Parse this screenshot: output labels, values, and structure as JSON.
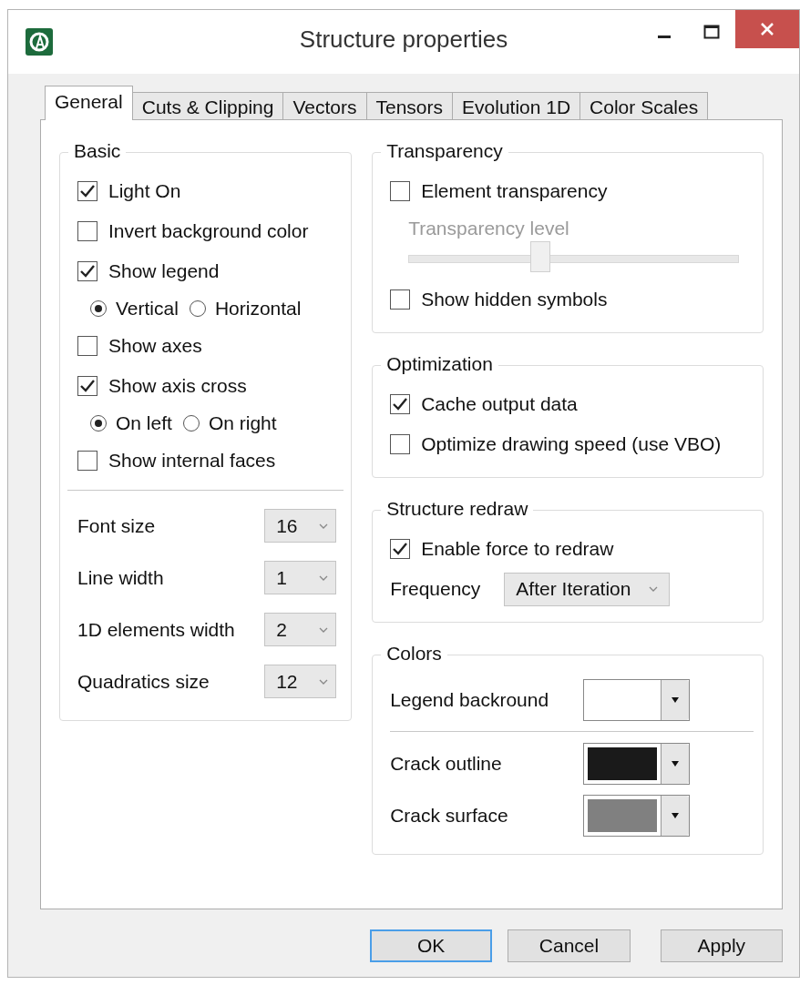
{
  "window": {
    "title": "Structure properties"
  },
  "tabs": [
    {
      "label": "General",
      "selected": true
    },
    {
      "label": "Cuts & Clipping",
      "selected": false
    },
    {
      "label": "Vectors",
      "selected": false
    },
    {
      "label": "Tensors",
      "selected": false
    },
    {
      "label": "Evolution 1D",
      "selected": false
    },
    {
      "label": "Color Scales",
      "selected": false
    }
  ],
  "basic": {
    "title": "Basic",
    "items": [
      {
        "kind": "checkbox",
        "label": "Light On",
        "checked": true
      },
      {
        "kind": "checkbox",
        "label": "Invert background color",
        "checked": false
      },
      {
        "kind": "checkbox",
        "label": "Show legend",
        "checked": true
      },
      {
        "kind": "radios",
        "options": [
          {
            "label": "Vertical",
            "selected": true
          },
          {
            "label": "Horizontal",
            "selected": false
          }
        ]
      },
      {
        "kind": "checkbox",
        "label": "Show axes",
        "checked": false
      },
      {
        "kind": "checkbox",
        "label": "Show axis cross",
        "checked": true
      },
      {
        "kind": "radios",
        "options": [
          {
            "label": "On left",
            "selected": true
          },
          {
            "label": "On right",
            "selected": false
          }
        ]
      },
      {
        "kind": "checkbox",
        "label": "Show internal faces",
        "checked": false
      }
    ],
    "dropdowns": [
      {
        "label": "Font size",
        "value": "16"
      },
      {
        "label": "Line width",
        "value": "1"
      },
      {
        "label": "1D elements width",
        "value": "2"
      },
      {
        "label": "Quadratics size",
        "value": "12"
      }
    ]
  },
  "transparency": {
    "title": "Transparency",
    "items": [
      {
        "kind": "checkbox",
        "label": "Element transparency",
        "checked": false
      },
      {
        "kind": "slider",
        "label": "Transparency level",
        "level": 0.4,
        "disabled": true
      },
      {
        "kind": "checkbox",
        "label": "Show hidden symbols",
        "checked": false
      }
    ]
  },
  "optimization": {
    "title": "Optimization",
    "items": [
      {
        "kind": "checkbox",
        "label": "Cache output data",
        "checked": true
      },
      {
        "kind": "checkbox",
        "label": "Optimize drawing speed (use VBO)",
        "checked": false
      }
    ]
  },
  "structure_redraw": {
    "title": "Structure redraw",
    "items": [
      {
        "kind": "checkbox",
        "label": "Enable force to redraw",
        "checked": true
      },
      {
        "kind": "dropdown",
        "label": "Frequency",
        "value": "After Iteration"
      }
    ]
  },
  "colors": {
    "title": "Colors",
    "items": [
      {
        "kind": "color",
        "label": "Legend backround",
        "color": "#ffffff"
      },
      {
        "kind": "separator"
      },
      {
        "kind": "color",
        "label": "Crack outline",
        "color": "#1a1a1a"
      },
      {
        "kind": "color",
        "label": "Crack surface",
        "color": "#808080"
      }
    ]
  },
  "buttons": [
    {
      "label": "OK",
      "default": true
    },
    {
      "label": "Cancel",
      "default": false
    },
    {
      "label": "Apply",
      "default": false
    }
  ]
}
